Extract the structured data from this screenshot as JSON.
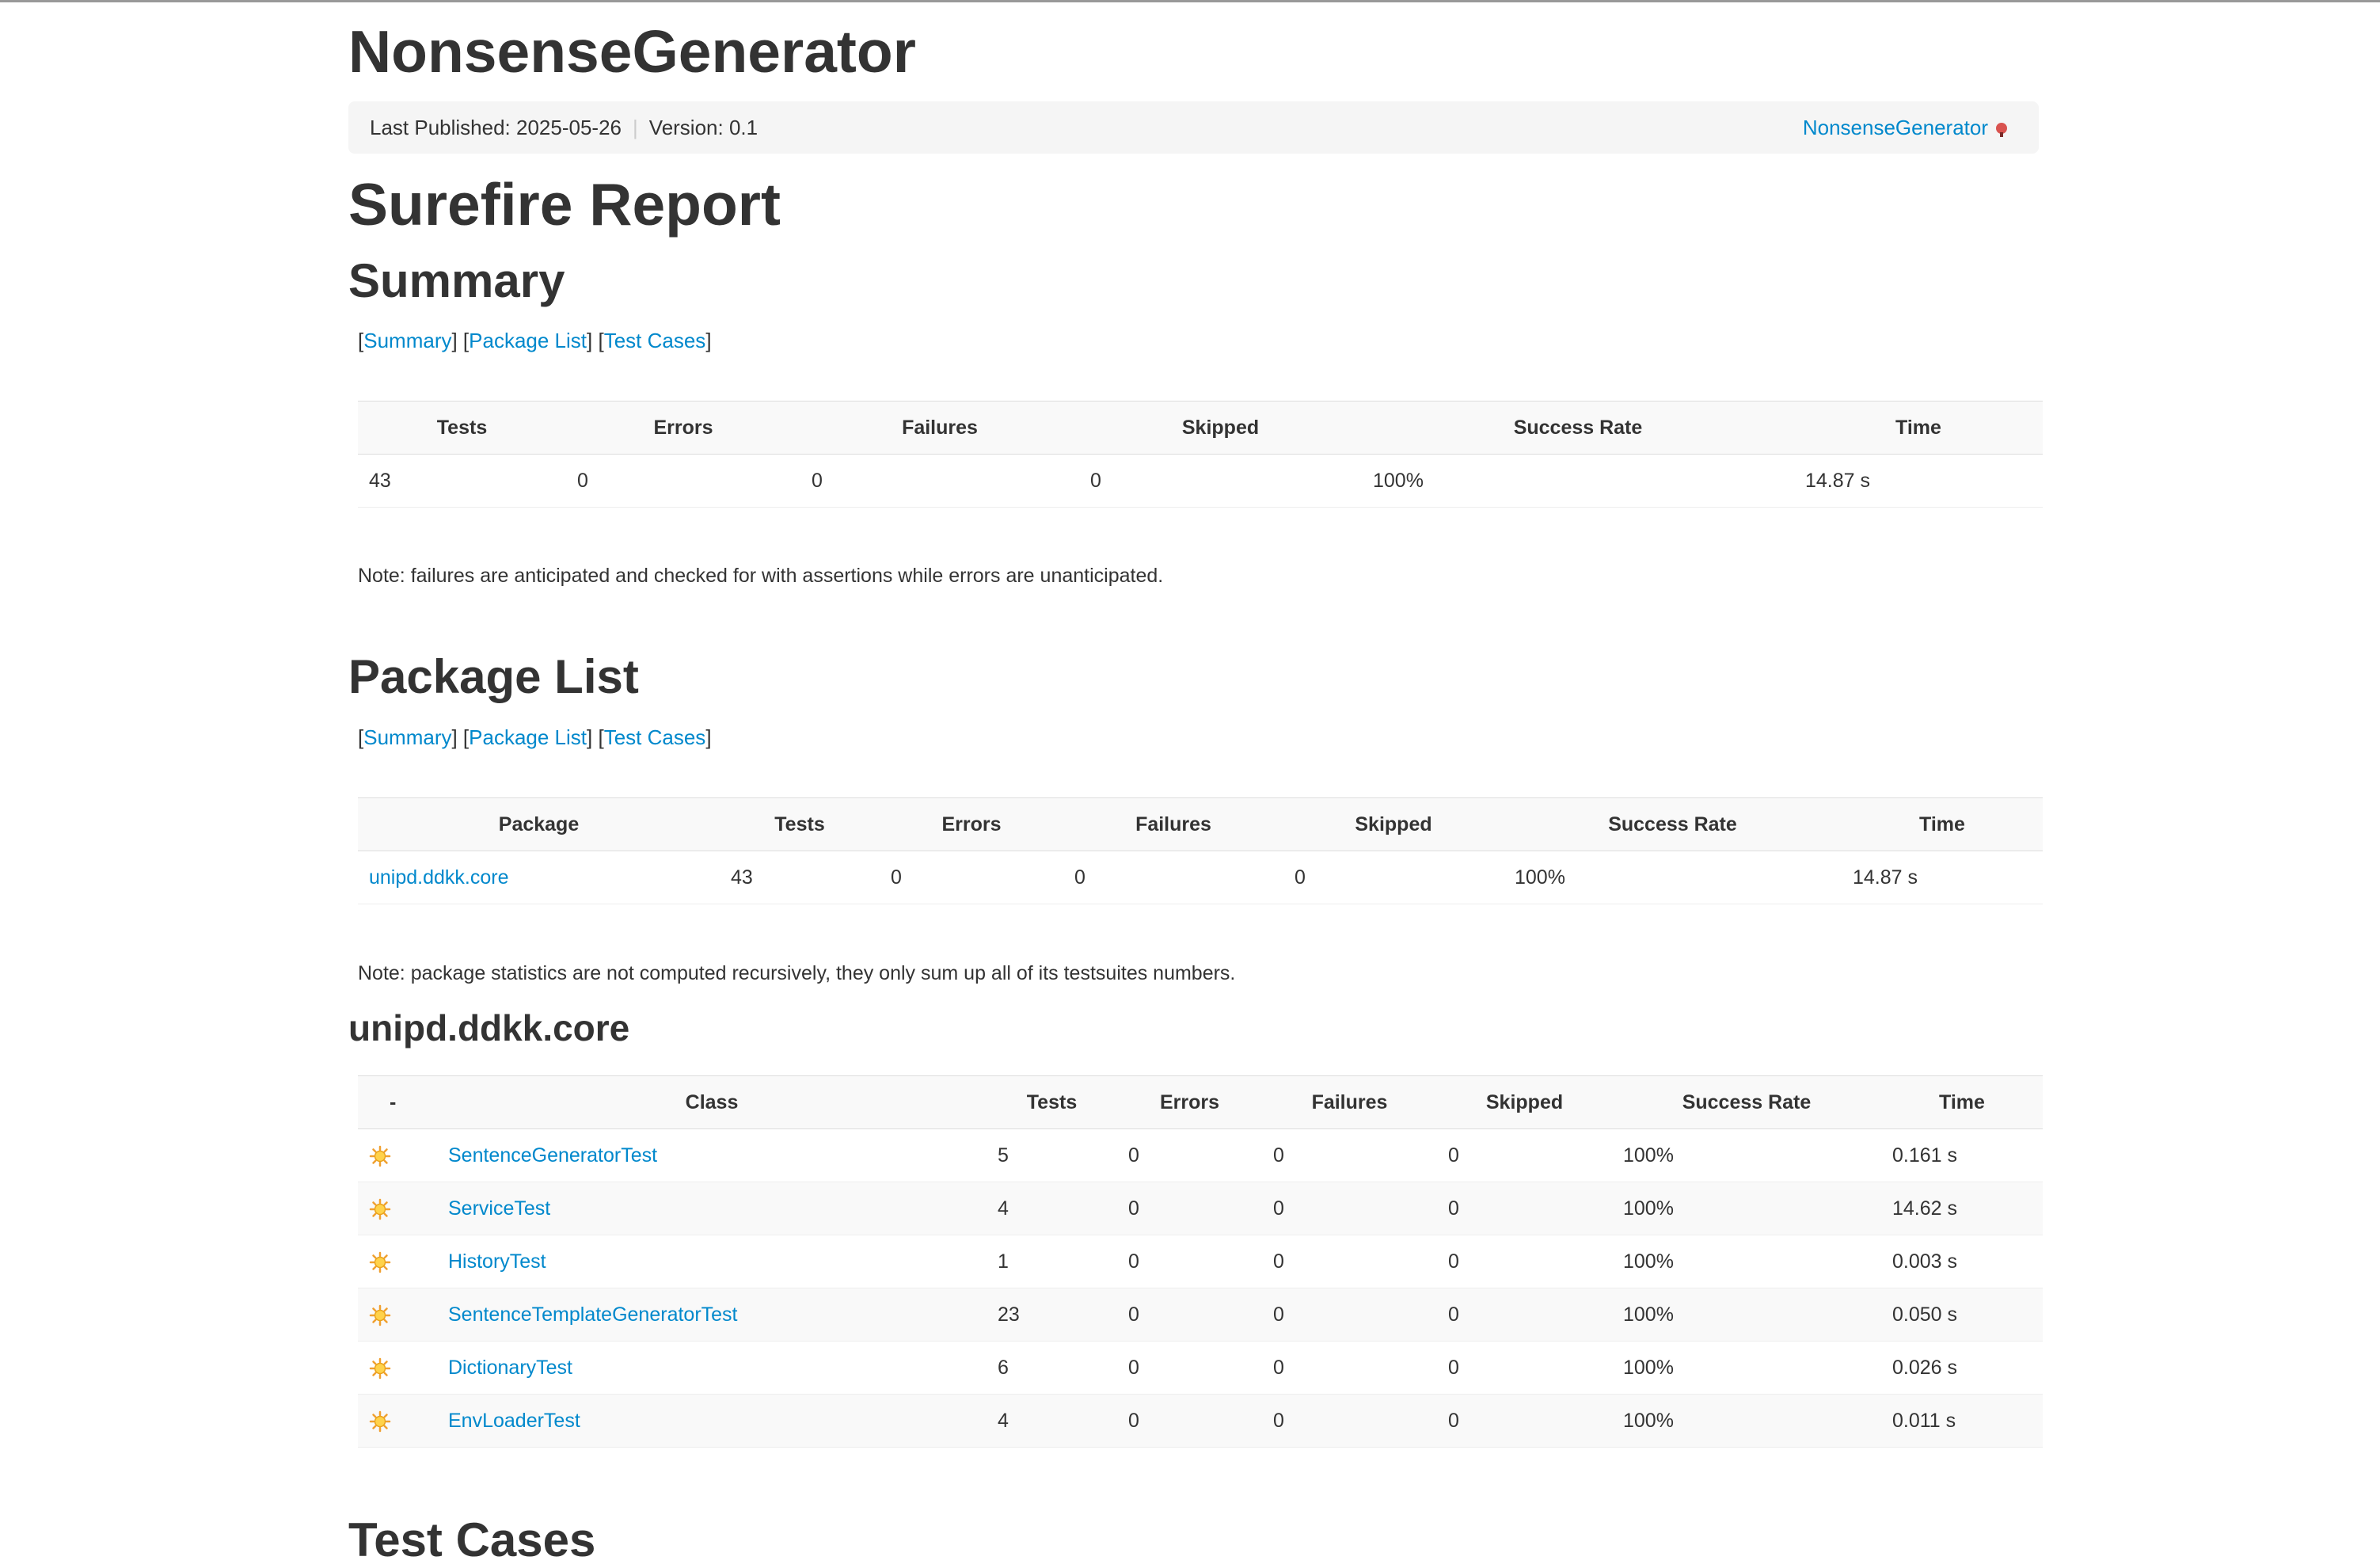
{
  "site_title": "NonsenseGenerator",
  "breadcrumb": {
    "last_published": "Last Published: 2025-05-26",
    "version": "Version: 0.1",
    "project_link": "NonsenseGenerator"
  },
  "report_title": "Surefire Report",
  "nav": {
    "summary": "Summary",
    "package_list": "Package List",
    "test_cases": "Test Cases"
  },
  "summary": {
    "heading": "Summary",
    "columns": [
      "Tests",
      "Errors",
      "Failures",
      "Skipped",
      "Success Rate",
      "Time"
    ],
    "row": [
      "43",
      "0",
      "0",
      "0",
      "100%",
      "14.87 s"
    ],
    "note": "Note: failures are anticipated and checked for with assertions while errors are unanticipated."
  },
  "package_list": {
    "heading": "Package List",
    "columns": [
      "Package",
      "Tests",
      "Errors",
      "Failures",
      "Skipped",
      "Success Rate",
      "Time"
    ],
    "row": [
      "unipd.ddkk.core",
      "43",
      "0",
      "0",
      "0",
      "100%",
      "14.87 s"
    ],
    "note": "Note: package statistics are not computed recursively, they only sum up all of its testsuites numbers."
  },
  "package_detail": {
    "heading": "unipd.ddkk.core",
    "columns": [
      "-",
      "Class",
      "Tests",
      "Errors",
      "Failures",
      "Skipped",
      "Success Rate",
      "Time"
    ],
    "rows": [
      {
        "class": "SentenceGeneratorTest",
        "tests": "5",
        "errors": "0",
        "failures": "0",
        "skipped": "0",
        "rate": "100%",
        "time": "0.161 s"
      },
      {
        "class": "ServiceTest",
        "tests": "4",
        "errors": "0",
        "failures": "0",
        "skipped": "0",
        "rate": "100%",
        "time": "14.62 s"
      },
      {
        "class": "HistoryTest",
        "tests": "1",
        "errors": "0",
        "failures": "0",
        "skipped": "0",
        "rate": "100%",
        "time": "0.003 s"
      },
      {
        "class": "SentenceTemplateGeneratorTest",
        "tests": "23",
        "errors": "0",
        "failures": "0",
        "skipped": "0",
        "rate": "100%",
        "time": "0.050 s"
      },
      {
        "class": "DictionaryTest",
        "tests": "6",
        "errors": "0",
        "failures": "0",
        "skipped": "0",
        "rate": "100%",
        "time": "0.026 s"
      },
      {
        "class": "EnvLoaderTest",
        "tests": "4",
        "errors": "0",
        "failures": "0",
        "skipped": "0",
        "rate": "100%",
        "time": "0.011 s"
      }
    ]
  },
  "test_cases_heading": "Test Cases",
  "icons": {
    "status": "success-sun-icon",
    "external": "external-link-icon"
  },
  "colors": {
    "link": "#0088cc",
    "header_bg": "#f9f9f9",
    "breadcrumb_bg": "#f5f5f5"
  }
}
